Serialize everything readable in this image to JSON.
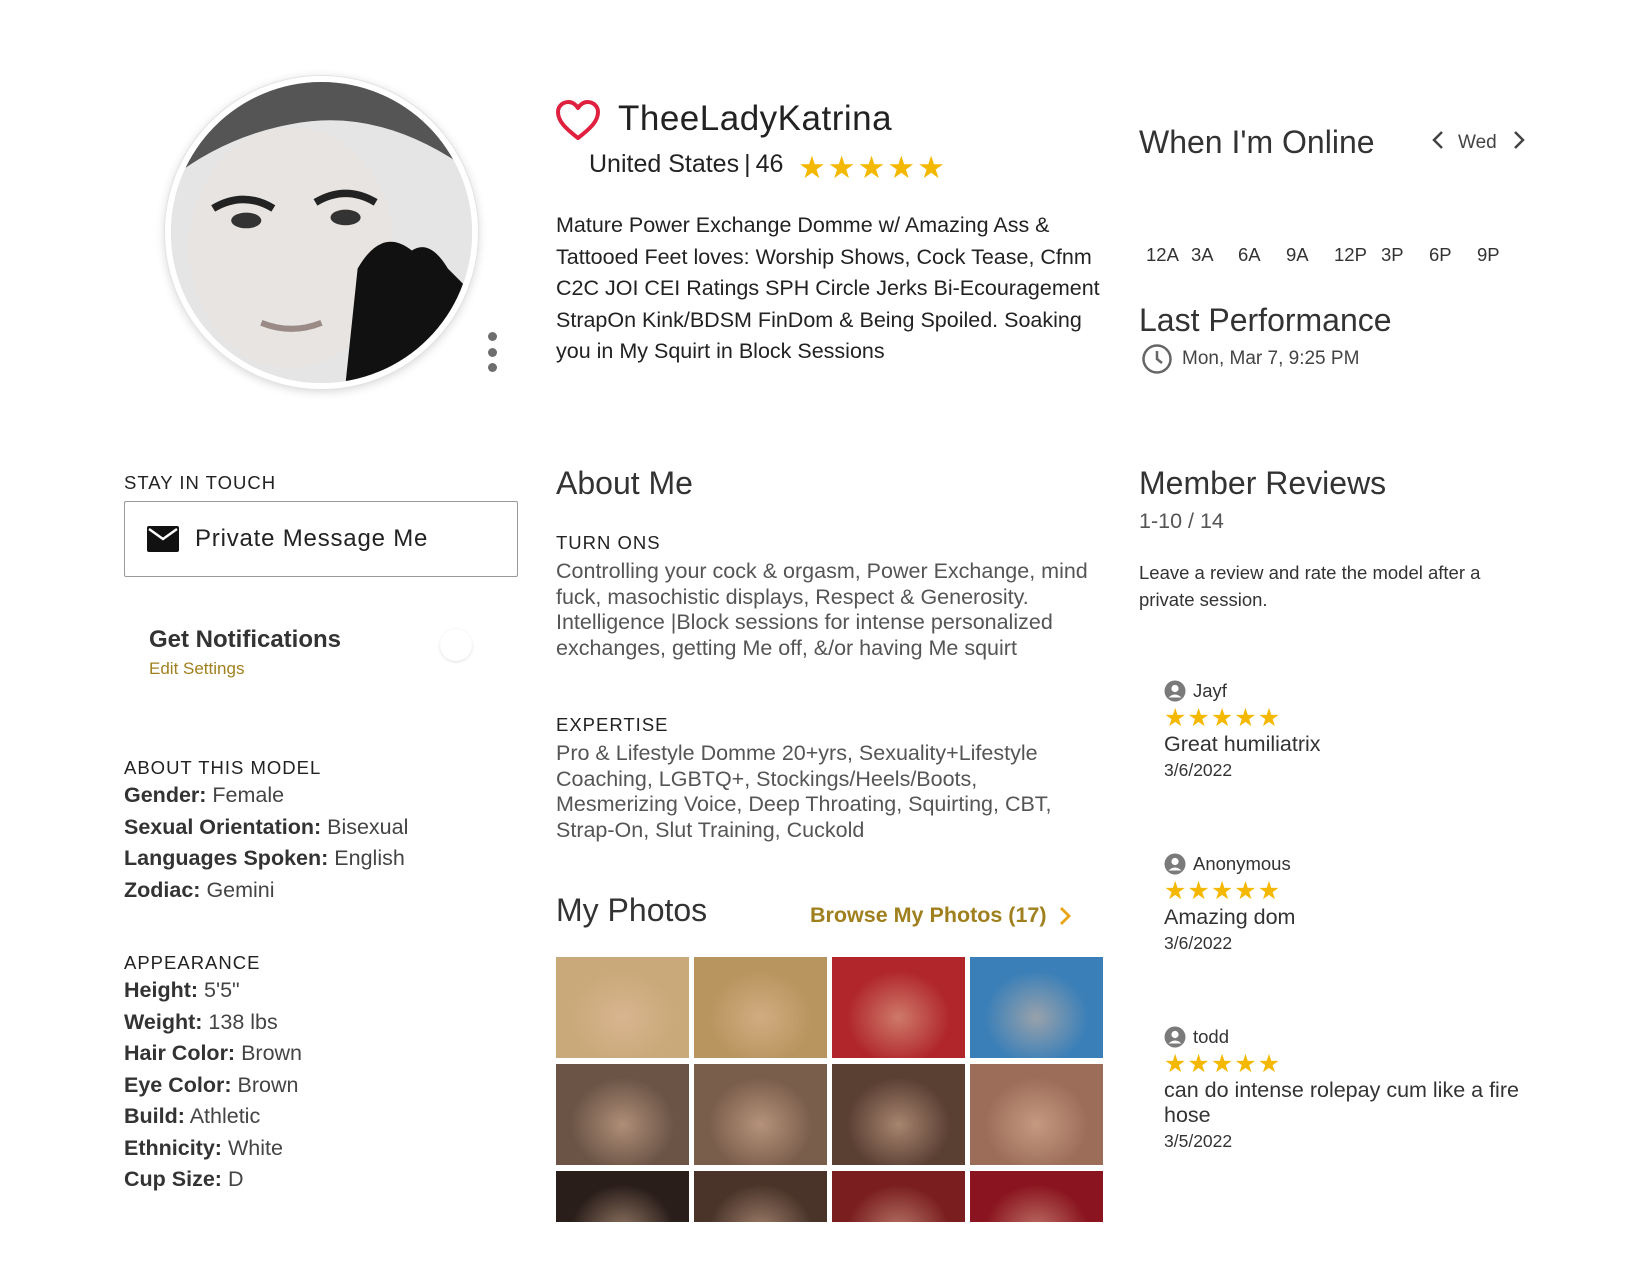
{
  "profile": {
    "name": "TheeLadyKatrina",
    "country": "United States",
    "separator": "|",
    "age": "46",
    "rating_stars": 5,
    "bio": "Mature Power Exchange Domme w/ Amazing Ass & Tattooed Feet loves: Worship Shows, Cock Tease, Cfnm C2C JOI CEI Ratings SPH Circle Jerks Bi-Ecouragement StrapOn Kink/BDSM FinDom & Being Spoiled. Soaking you in My Squirt in Block Sessions",
    "favorite_icon": "heart-outline-icon",
    "accent_color": "#e0203f"
  },
  "schedule": {
    "title": "When I'm Online",
    "day": "Wed",
    "hours": [
      "12A",
      "3A",
      "6A",
      "9A",
      "12P",
      "3P",
      "6P",
      "9P"
    ]
  },
  "last_performance": {
    "title": "Last Performance",
    "time": "Mon, Mar 7, 9:25 PM"
  },
  "stay_in_touch": {
    "label": "STAY IN TOUCH",
    "button": "Private Message Me",
    "notifications_title": "Get Notifications",
    "edit_settings": "Edit Settings"
  },
  "about_model": {
    "label": "ABOUT THIS MODEL",
    "rows": [
      {
        "key": "Gender:",
        "value": "Female"
      },
      {
        "key": "Sexual Orientation:",
        "value": "Bisexual"
      },
      {
        "key": "Languages Spoken:",
        "value": "English"
      },
      {
        "key": "Zodiac:",
        "value": "Gemini"
      }
    ]
  },
  "appearance": {
    "label": "APPEARANCE",
    "rows": [
      {
        "key": "Height:",
        "value": "5'5\""
      },
      {
        "key": "Weight:",
        "value": "138 lbs"
      },
      {
        "key": "Hair Color:",
        "value": "Brown"
      },
      {
        "key": "Eye Color:",
        "value": "Brown"
      },
      {
        "key": "Build:",
        "value": "Athletic"
      },
      {
        "key": "Ethnicity:",
        "value": "White"
      },
      {
        "key": "Cup Size:",
        "value": "D"
      }
    ]
  },
  "about_me": {
    "title": "About Me",
    "turn_ons_label": "TURN ONS",
    "turn_ons": "Controlling your cock & orgasm, Power Exchange, mind fuck, masochistic displays, Respect & Generosity. Intelligence |Block sessions for intense personalized exchanges, getting Me off, &/or having Me squirt",
    "expertise_label": "EXPERTISE",
    "expertise": "Pro & Lifestyle Domme 20+yrs, Sexuality+Lifestyle Coaching, LGBTQ+, Stockings/Heels/Boots, Mesmerizing Voice, Deep Throating, Squirting, CBT, Strap-On, Slut Training, Cuckold"
  },
  "photos": {
    "title": "My Photos",
    "browse": "Browse My Photos (17)",
    "thumb_colors": [
      "#c9a97a",
      "#b8955e",
      "#b0262a",
      "#3a7fb8",
      "#6b5446",
      "#7a5e4c",
      "#5a3f33",
      "#9c6e5a",
      "#2a1e1a",
      "#4a342a",
      "#7a1e20",
      "#8a1520"
    ]
  },
  "reviews": {
    "title": "Member Reviews",
    "range": "1-10 / 14",
    "prompt": "Leave a review and rate the model after a private session.",
    "items": [
      {
        "user": "Jayf",
        "stars": 5,
        "text": "Great humiliatrix",
        "date": "3/6/2022"
      },
      {
        "user": "Anonymous",
        "stars": 5,
        "text": "Amazing dom",
        "date": "3/6/2022"
      },
      {
        "user": "todd",
        "stars": 5,
        "text": "can do intense rolepay cum like a fire hose",
        "date": "3/5/2022"
      }
    ]
  },
  "colors": {
    "star": "#f5b800",
    "gold_link": "#a0801e"
  }
}
